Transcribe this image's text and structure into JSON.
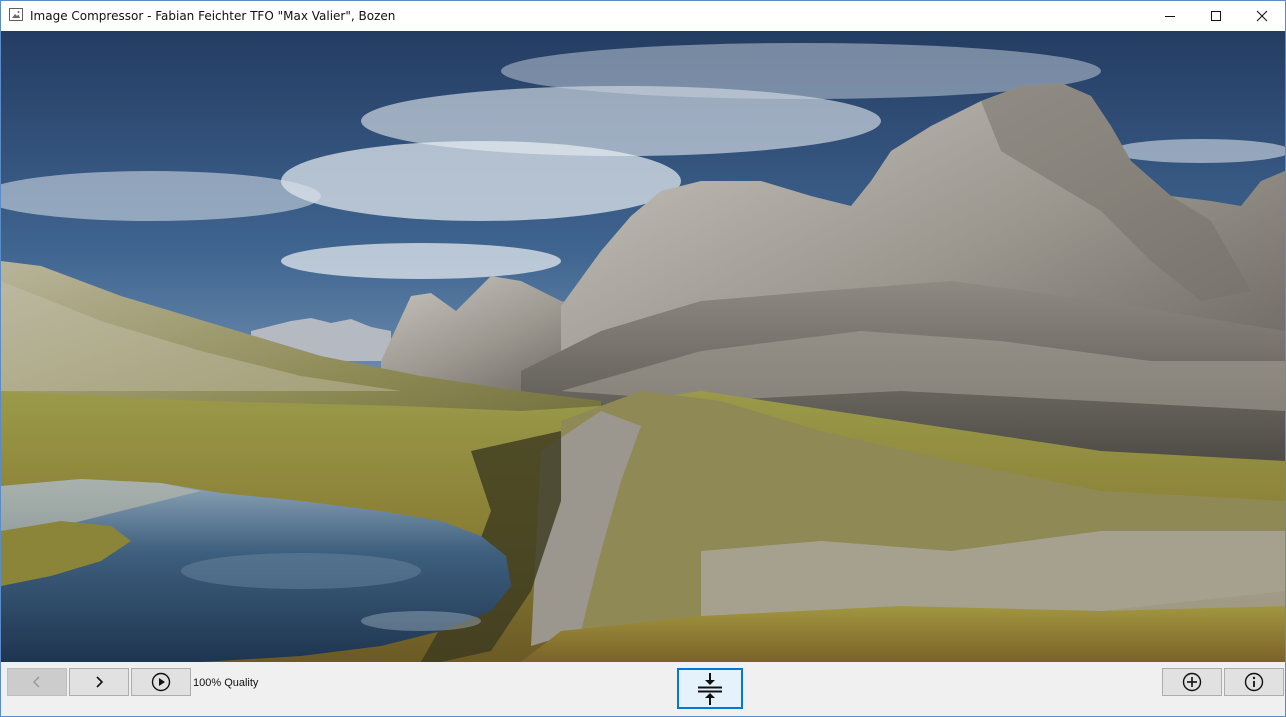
{
  "window": {
    "title": "Image Compressor - Fabian Feichter TFO \"Max Valier\", Bozen",
    "app_icon": "picture-icon",
    "controls": [
      "minimize-icon",
      "maximize-icon",
      "close-icon"
    ]
  },
  "viewer": {
    "image_description_icon": "mountain-landscape-photo"
  },
  "toolbar": {
    "prev_icon": "chevron-left-icon",
    "prev_enabled": false,
    "next_icon": "chevron-right-icon",
    "play_icon": "play-circle-icon",
    "quality_label": "100% Quality",
    "compress_icon": "compress-vertical-icon",
    "add_icon": "plus-circle-icon",
    "info_icon": "info-circle-icon"
  },
  "colors": {
    "accent": "#0078d7",
    "toolbar_bg": "#f0f0f0",
    "button_bg": "#e1e1e1",
    "window_border": "#5b8cc8"
  }
}
